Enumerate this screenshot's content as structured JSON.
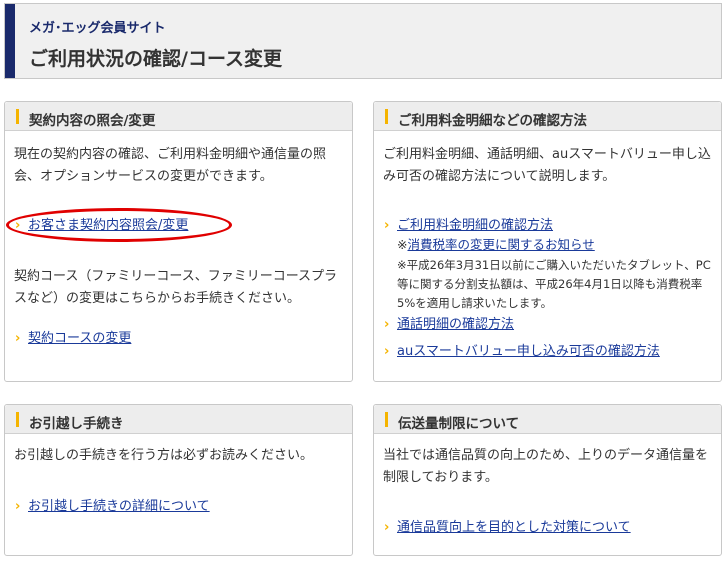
{
  "header": {
    "site_name": "メガ･エッグ会員サイト",
    "page_title": "ご利用状況の確認/コース変更"
  },
  "panels": {
    "contract": {
      "title": "契約内容の照会/変更",
      "desc": "現在の契約内容の確認、ご利用料金明細や通信量の照会、オプションサービスの変更ができます。",
      "link1": "お客さま契約内容照会/変更",
      "desc2": "契約コース（ファミリーコース、ファミリーコースプラスなど）の変更はこちらからお手続きください。",
      "link2": "契約コースの変更"
    },
    "billing": {
      "title": "ご利用料金明細などの確認方法",
      "desc": "ご利用料金明細、通話明細、auスマートバリュー申し込み可否の確認方法について説明します。",
      "link1": "ご利用料金明細の確認方法",
      "note_mark": "※",
      "note_link": "消費税率の変更に関するお知らせ",
      "note_text": "※平成26年3月31日以前にご購入いただいたタブレット、PC等に関する分割支払額は、平成26年4月1日以降も消費税率5%を適用し請求いたします。",
      "link2": "通話明細の確認方法",
      "link3": "auスマートバリュー申し込み可否の確認方法"
    },
    "moving": {
      "title": "お引越し手続き",
      "desc": "お引越しの手続きを行う方は必ずお読みください。",
      "link1": "お引越し手続きの詳細について"
    },
    "traffic": {
      "title": "伝送量制限について",
      "desc": "当社では通信品質の向上のため、上りのデータ通信量を制限しております。",
      "link1": "通信品質向上を目的とした対策について"
    }
  },
  "colors": {
    "accent_navy": "#1a2a6c",
    "accent_yellow": "#f5b400",
    "link": "#1a3a9a",
    "highlight_red": "#e00000"
  }
}
